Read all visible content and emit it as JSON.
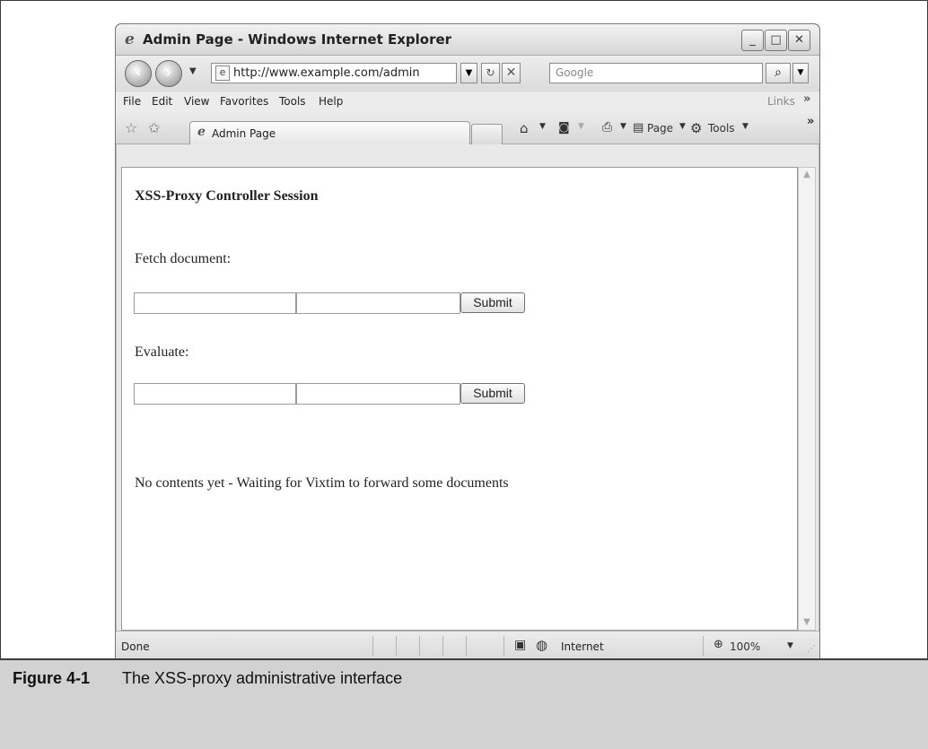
{
  "window": {
    "title": "Admin Page - Windows Internet Explorer",
    "controls": {
      "minimize": "_",
      "maximize": "□",
      "close": "✕"
    }
  },
  "toolbar": {
    "address_url": "http://www.example.com/admin",
    "search_placeholder": "Google"
  },
  "menu": {
    "items": [
      "File",
      "Edit",
      "View",
      "Favorites",
      "Tools",
      "Help"
    ],
    "links_label": "Links"
  },
  "tabs": {
    "active_tab_label": "Admin Page"
  },
  "commandbar": {
    "page_label": "Page",
    "tools_label": "Tools"
  },
  "page": {
    "heading": "XSS-Proxy Controller Session",
    "fetch_label": "Fetch document:",
    "evaluate_label": "Evaluate:",
    "submit_label": "Submit",
    "status_message": "No contents yet - Waiting for Vixtim to forward some documents"
  },
  "statusbar": {
    "status_text": "Done",
    "zone_label": "Internet",
    "zoom_label": "100%"
  },
  "figure": {
    "number": "Figure 4-1",
    "caption": "The XSS-proxy administrative interface"
  }
}
